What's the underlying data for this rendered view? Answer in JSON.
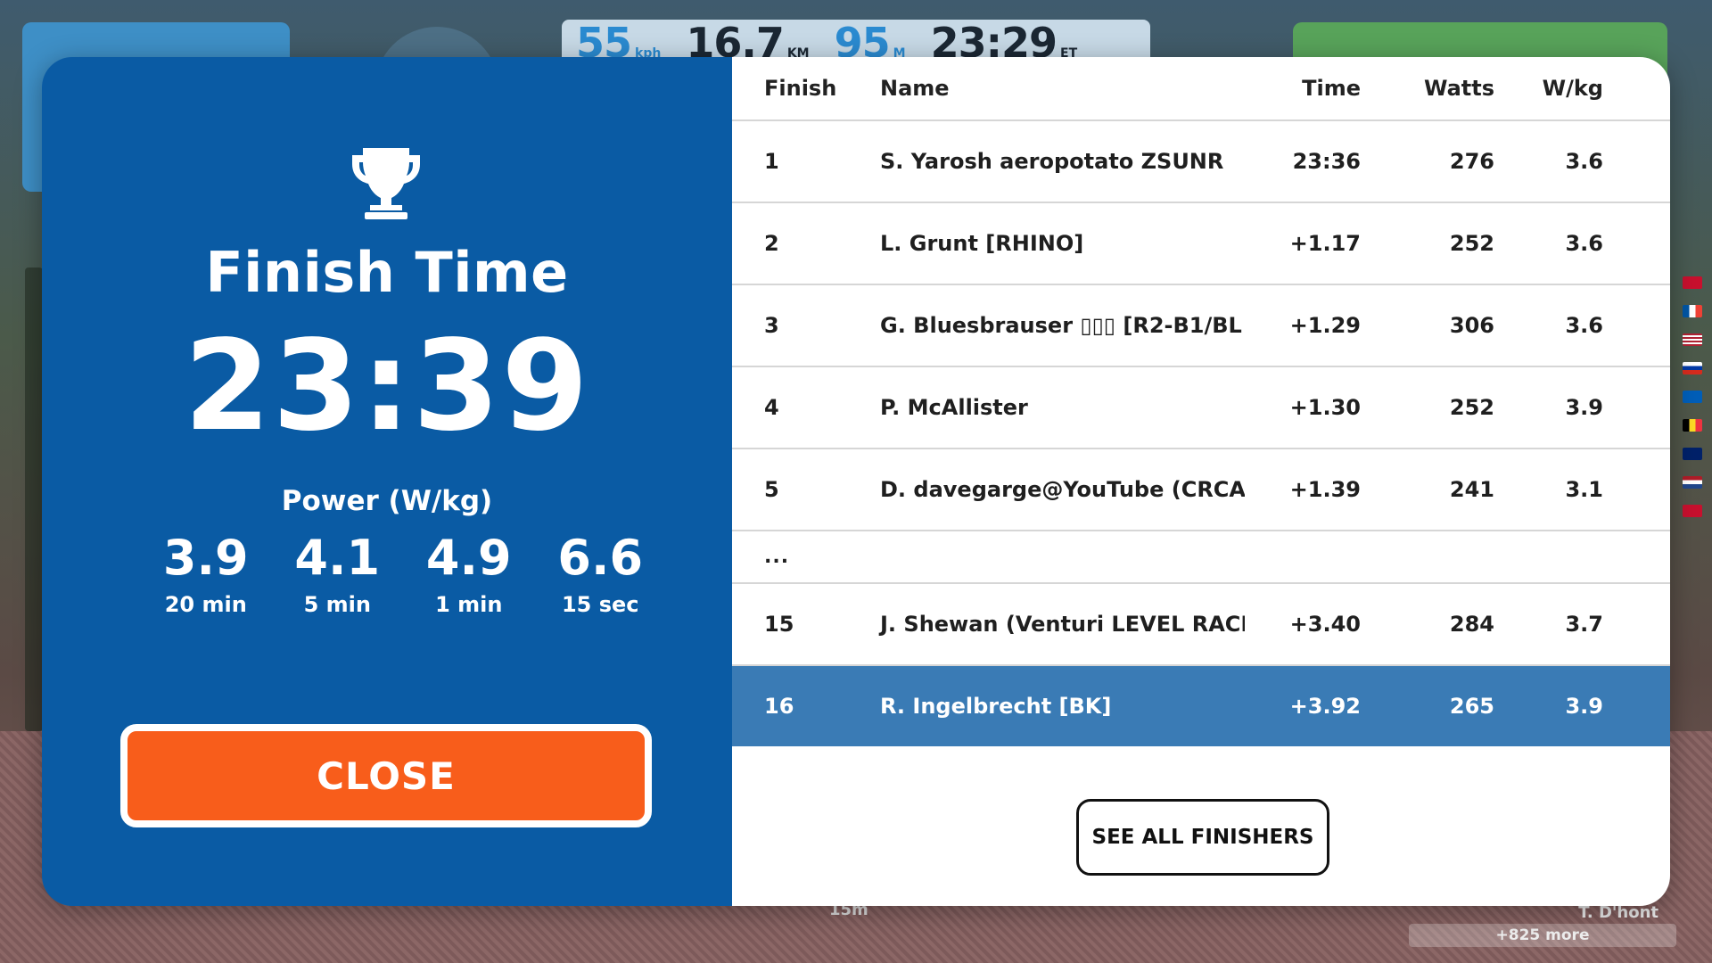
{
  "hud": {
    "speed": "55",
    "speed_unit": "kph",
    "distance": "16.7",
    "distance_unit": "KM",
    "elevation": "95",
    "elevation_unit": "M",
    "elapsed": "23:29",
    "elapsed_unit": "ET"
  },
  "background": {
    "more_label": "+825 more",
    "nearby_rider": "T. D'hont",
    "elevation_marker": "15m"
  },
  "summary": {
    "heading": "Finish Time",
    "finish_time": "23:39",
    "power_label": "Power (W/kg)",
    "power": [
      {
        "value": "3.9",
        "duration": "20 min"
      },
      {
        "value": "4.1",
        "duration": "5 min"
      },
      {
        "value": "4.9",
        "duration": "1 min"
      },
      {
        "value": "6.6",
        "duration": "15 sec"
      }
    ],
    "close_label": "CLOSE"
  },
  "results": {
    "columns": {
      "finish": "Finish",
      "name": "Name",
      "time": "Time",
      "watts": "Watts",
      "wkg": "W/kg"
    },
    "rows": [
      {
        "finish": "1",
        "name": "S. Yarosh aeropotato ZSUNR",
        "time": "23:36",
        "watts": "276",
        "wkg": "3.6"
      },
      {
        "finish": "2",
        "name": "L. Grunt [RHINO]",
        "time": "+1.17",
        "watts": "252",
        "wkg": "3.6"
      },
      {
        "finish": "3",
        "name": "G. Bluesbrauser ▯▯▯ [R2-B1/BL",
        "time": "+1.29",
        "watts": "306",
        "wkg": "3.6"
      },
      {
        "finish": "4",
        "name": "P. McAllister",
        "time": "+1.30",
        "watts": "252",
        "wkg": "3.9"
      },
      {
        "finish": "5",
        "name": "D. davegarge@YouTube (CRCA/I",
        "time": "+1.39",
        "watts": "241",
        "wkg": "3.1"
      }
    ],
    "ellipsis": "...",
    "rows_after": [
      {
        "finish": "15",
        "name": "J. Shewan (Venturi LEVEL RACIN",
        "time": "+3.40",
        "watts": "284",
        "wkg": "3.7"
      }
    ],
    "current_user": {
      "finish": "16",
      "name": "R. Ingelbrecht [BK]",
      "time": "+3.92",
      "watts": "265",
      "wkg": "3.9"
    },
    "see_all_label": "SEE ALL FINISHERS"
  },
  "colors": {
    "panel_blue": "#0a5ba4",
    "close_orange": "#f85d1b",
    "highlight_row": "#3a7bb5"
  }
}
